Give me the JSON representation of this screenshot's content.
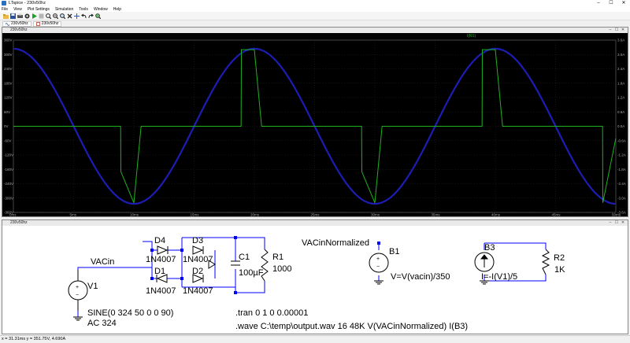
{
  "window": {
    "title": "LTspice - 230v50hz",
    "minimize": "–",
    "maximize": "☐",
    "close": "✕"
  },
  "menu": [
    "File",
    "View",
    "Plot Settings",
    "Simulation",
    "Tools",
    "Window",
    "Help"
  ],
  "toolbar": [
    "open-icon",
    "save-icon",
    "print-icon",
    "settings-icon",
    "run-icon",
    "halt-icon",
    "zoom-in-icon",
    "zoom-out-icon",
    "zoom-fit-icon",
    "delete-icon",
    "move-icon",
    "undo-icon",
    "redo-icon",
    "search-icon"
  ],
  "tabs": [
    {
      "label": "230v50hz"
    },
    {
      "label": "230v50hz"
    }
  ],
  "plot": {
    "window_title": "230v50hz",
    "trace_label": "I(R1)",
    "left_ticks": [
      "360V",
      "300V",
      "240V",
      "180V",
      "120V",
      "60V",
      "0V",
      "-60V",
      "-120V",
      "-180V",
      "-240V",
      "-300V",
      "-360V"
    ],
    "right_ticks": [
      "3.6A",
      "3.0A",
      "2.4A",
      "1.8A",
      "1.2A",
      "0.6A",
      "0.0A",
      "-0.6A",
      "-1.2A",
      "-1.8A",
      "-2.4A",
      "-3.0A",
      "-3.6A"
    ],
    "x_ticks": [
      "0ms",
      "5ms",
      "10ms",
      "15ms",
      "20ms",
      "25ms",
      "30ms",
      "35ms",
      "40ms",
      "45ms",
      "50ms"
    ]
  },
  "chart_data": {
    "type": "line",
    "title": "",
    "x_unit": "ms",
    "xlim": [
      0,
      50
    ],
    "ylim_left": [
      -360,
      360
    ],
    "ylim_right": [
      -3.6,
      3.6
    ],
    "series": [
      {
        "name": "",
        "color": "#1d1db4",
        "axis": "left",
        "x": [
          0,
          2.5,
          5,
          7.5,
          10,
          12.5,
          15,
          17.5,
          20,
          22.5,
          25,
          27.5,
          30,
          32.5,
          35,
          37.5,
          40,
          42.5,
          45,
          47.5,
          50
        ],
        "y": [
          324,
          229,
          0,
          -229,
          -324,
          -229,
          0,
          229,
          324,
          229,
          0,
          -229,
          -324,
          -229,
          0,
          229,
          324,
          229,
          0,
          -229,
          -324
        ]
      },
      {
        "name": "I(R1)",
        "color": "#1fb21f",
        "axis": "right",
        "x": [
          0,
          8.9,
          8.92,
          10,
          10.6,
          18.9,
          18.92,
          20,
          20.6,
          28.9,
          28.92,
          30,
          30.6,
          38.9,
          38.92,
          40,
          40.6,
          48.9,
          48.92,
          50
        ],
        "y": [
          0,
          0,
          -1.9,
          -3.2,
          0,
          0,
          3.2,
          3.2,
          0,
          0,
          -1.9,
          -3.2,
          0,
          0,
          3.2,
          3.2,
          0,
          0,
          -3.2,
          -0.5
        ]
      }
    ]
  },
  "schematic": {
    "window_title": "230v50hz",
    "labels": {
      "vacin": "VACin",
      "v1": "V1",
      "v1_value": "SINE(0 324 50 0 0 90)",
      "v1_ac": "AC 324",
      "d1": "D1",
      "d1_model": "1N4007",
      "d2": "D2",
      "d2_model": "1N4007",
      "d3": "D3",
      "d3_model": "1N4007",
      "d4": "D4",
      "d4_model": "1N4007",
      "c1": "C1",
      "c1_value": "100µF",
      "r1": "R1",
      "r1_value": "1000",
      "vacin_norm": "VACinNormalized",
      "b1": "B1",
      "b1_value": "V=V(vacin)/350",
      "b3": "B3",
      "b3_value": "I=-I(V1)/5",
      "r2": "R2",
      "r2_value": "1K",
      "tran": ".tran 0 1 0 0.00001",
      "wave": ".wave C:\\temp\\output.wav 16 48K V(VACinNormalized) I(B3)"
    }
  },
  "status": {
    "text": "x = 31.31ms   y = 351.75V, 4.690A"
  }
}
